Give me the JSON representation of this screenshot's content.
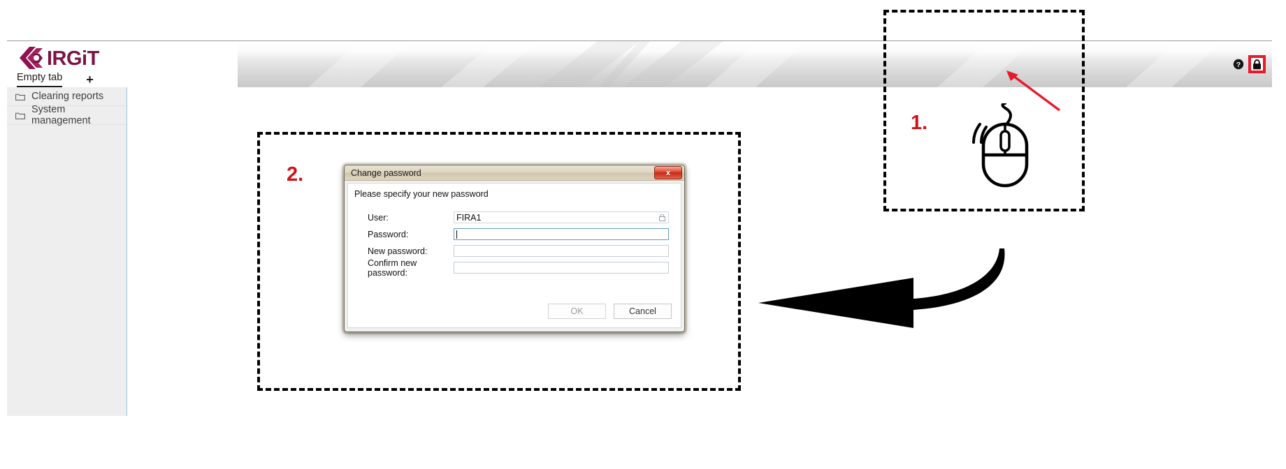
{
  "app": {
    "brand_name": "IRGiT",
    "brand_color": "#7b1445",
    "accent_red": "#d41117",
    "highlight_red": "#e8192c"
  },
  "tabs": {
    "active_tab_label": "Empty tab",
    "add_tab_label": "+"
  },
  "header_icons": {
    "help": "help-icon",
    "lock": "lock-icon"
  },
  "sidebar": {
    "items": [
      {
        "label": "Clearing reports",
        "icon": "folder-icon"
      },
      {
        "label": "System management",
        "icon": "folder-icon"
      }
    ]
  },
  "dialog": {
    "title": "Change password",
    "close_label": "x",
    "prompt": "Please specify your new password",
    "fields": [
      {
        "label": "User:",
        "value": "FIRA1",
        "placeholder": "",
        "readonly": true,
        "focused": false
      },
      {
        "label": "Password:",
        "value": "",
        "placeholder": "",
        "readonly": false,
        "focused": true
      },
      {
        "label": "New password:",
        "value": "",
        "placeholder": "",
        "readonly": false,
        "focused": false
      },
      {
        "label": "Confirm new password:",
        "value": "",
        "placeholder": "",
        "readonly": false,
        "focused": false
      }
    ],
    "buttons": {
      "ok_label": "OK",
      "cancel_label": "Cancel"
    }
  },
  "annotations": {
    "step_1": "1.",
    "step_2": "2."
  }
}
